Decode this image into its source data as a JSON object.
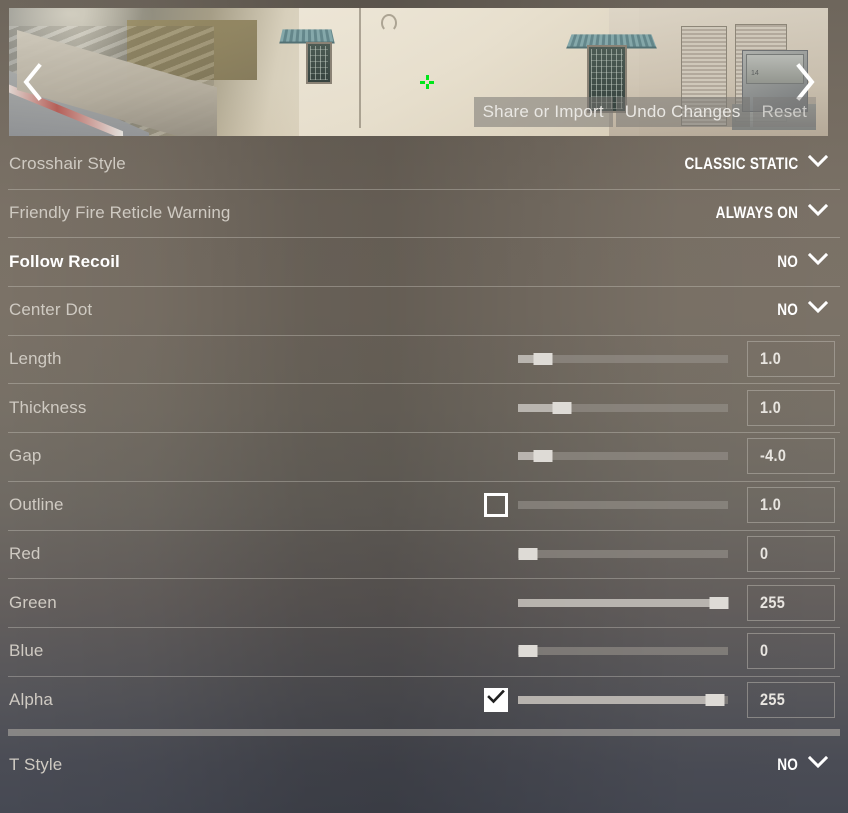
{
  "preview": {
    "left_arrow_icon": "chevron-left-icon",
    "right_arrow_icon": "chevron-right-icon",
    "crosshair_color": "#00e61a",
    "crate_label": "14",
    "buttons": [
      {
        "label": "Share or Import",
        "name": "share-or-import-button",
        "dim": false
      },
      {
        "label": "Undo Changes",
        "name": "undo-changes-button",
        "dim": false
      },
      {
        "label": "Reset",
        "name": "reset-button",
        "dim": true
      }
    ]
  },
  "settings": {
    "rows": [
      {
        "label": "Crosshair Style",
        "type": "dropdown",
        "value": "CLASSIC STATIC",
        "active": false
      },
      {
        "label": "Friendly Fire Reticle Warning",
        "type": "dropdown",
        "value": "ALWAYS ON",
        "active": false
      },
      {
        "label": "Follow Recoil",
        "type": "dropdown",
        "value": "NO",
        "active": true
      },
      {
        "label": "Center Dot",
        "type": "dropdown",
        "value": "NO",
        "active": false
      },
      {
        "label": "Length",
        "type": "slider",
        "value": "1.0",
        "percent": 12,
        "handle": true,
        "checkbox": null,
        "active": false
      },
      {
        "label": "Thickness",
        "type": "slider",
        "value": "1.0",
        "percent": 21,
        "handle": true,
        "checkbox": null,
        "active": false
      },
      {
        "label": "Gap",
        "type": "slider",
        "value": "-4.0",
        "percent": 12,
        "handle": true,
        "checkbox": null,
        "active": false
      },
      {
        "label": "Outline",
        "type": "slider",
        "value": "1.0",
        "percent": 0,
        "handle": false,
        "checkbox": false,
        "active": false
      },
      {
        "label": "Red",
        "type": "slider",
        "value": "0",
        "percent": 0,
        "handle": true,
        "checkbox": null,
        "active": false
      },
      {
        "label": "Green",
        "type": "slider",
        "value": "255",
        "percent": 97,
        "handle": true,
        "checkbox": null,
        "active": false
      },
      {
        "label": "Blue",
        "type": "slider",
        "value": "0",
        "percent": 0,
        "handle": true,
        "checkbox": null,
        "active": false
      },
      {
        "label": "Alpha",
        "type": "slider",
        "value": "255",
        "percent": 94,
        "handle": true,
        "checkbox": true,
        "active": false
      },
      {
        "label": "T Style",
        "type": "dropdown",
        "value": "NO",
        "active": false
      }
    ]
  },
  "colors": {
    "accent_white": "#ffffff",
    "label": "#cfcac2",
    "divider": "rgba(215,211,203,0.35)",
    "crosshair_green": "#00e61a"
  }
}
